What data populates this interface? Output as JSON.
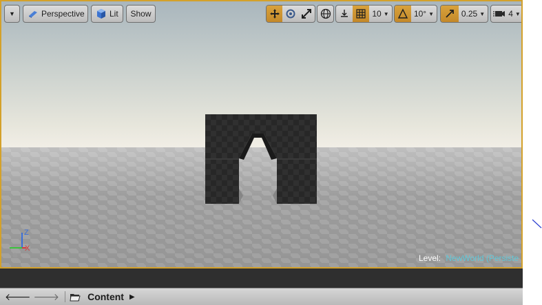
{
  "toolbar": {
    "view_mode": "Perspective",
    "lighting": "Lit",
    "show": "Show",
    "grid_snap": "10",
    "rotation_snap": "10°",
    "scale_snap": "0.25",
    "camera_speed": "4"
  },
  "viewport": {
    "level_label": "Level:",
    "level_name": "NewWorld (Persiste",
    "axis_z": "Z",
    "axis_x": "X"
  },
  "content_browser": {
    "path": "Content"
  },
  "colors": {
    "accent": "#c4892a",
    "level_name": "#5fc7d8",
    "status_bar": "#2f2f2f"
  },
  "icons": [
    "menu-caret-icon",
    "perspective-icon",
    "lit-icon",
    "translate-icon",
    "rotate-icon",
    "scale-icon",
    "world-icon",
    "surface-snap-icon",
    "grid-icon",
    "angle-icon",
    "scale-snap-icon",
    "camera-icon",
    "back-arrow-icon",
    "forward-arrow-icon",
    "folder-icon",
    "chevron-right-icon"
  ]
}
